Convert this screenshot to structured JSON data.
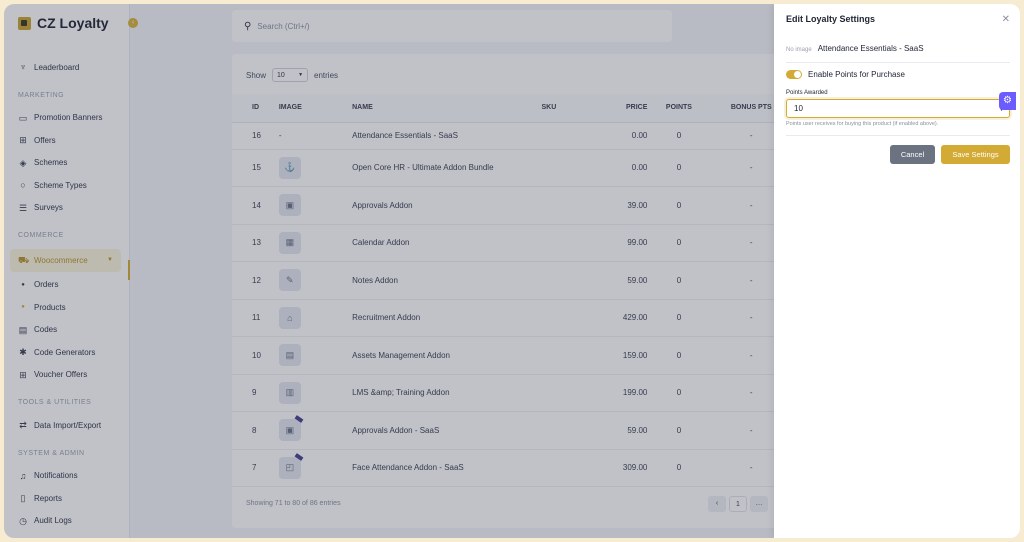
{
  "brand": {
    "name": "CZ Loyalty"
  },
  "sidebar": {
    "top_items": [
      {
        "label": "Leaderboard",
        "icon": "trophy-icon"
      }
    ],
    "sections": [
      {
        "label": "MARKETING",
        "items": [
          "Promotion Banners",
          "Offers",
          "Schemes",
          "Scheme Types",
          "Surveys"
        ]
      },
      {
        "label": "COMMERCE",
        "items": [
          "Woocommerce",
          "Orders",
          "Products",
          "Codes",
          "Code Generators",
          "Voucher Offers"
        ]
      },
      {
        "label": "TOOLS & UTILITIES",
        "items": [
          "Data Import/Export"
        ]
      },
      {
        "label": "SYSTEM & ADMIN",
        "items": [
          "Notifications",
          "Reports",
          "Audit Logs"
        ]
      }
    ]
  },
  "search": {
    "placeholder": "Search (Ctrl+/)"
  },
  "table": {
    "show_label": "Show",
    "entries_label": "entries",
    "page_size": "10",
    "columns": [
      "ID",
      "IMAGE",
      "NAME",
      "SKU",
      "PRICE",
      "POINTS",
      "BONUS PTS"
    ],
    "rows": [
      {
        "id": "16",
        "image": "-",
        "name": "Attendance Essentials - SaaS",
        "sku": "",
        "price": "0.00",
        "points": "0",
        "bonus": "-"
      },
      {
        "id": "15",
        "image": "",
        "name": "Open Core HR - Ultimate Addon Bundle",
        "sku": "",
        "price": "0.00",
        "points": "0",
        "bonus": "-"
      },
      {
        "id": "14",
        "image": "",
        "name": "Approvals Addon",
        "sku": "",
        "price": "39.00",
        "points": "0",
        "bonus": "-"
      },
      {
        "id": "13",
        "image": "",
        "name": "Calendar Addon",
        "sku": "",
        "price": "99.00",
        "points": "0",
        "bonus": "-"
      },
      {
        "id": "12",
        "image": "",
        "name": "Notes Addon",
        "sku": "",
        "price": "59.00",
        "points": "0",
        "bonus": "-"
      },
      {
        "id": "11",
        "image": "",
        "name": "Recruitment Addon",
        "sku": "",
        "price": "429.00",
        "points": "0",
        "bonus": "-"
      },
      {
        "id": "10",
        "image": "",
        "name": "Assets Management Addon",
        "sku": "",
        "price": "159.00",
        "points": "0",
        "bonus": "-"
      },
      {
        "id": "9",
        "image": "",
        "name": "LMS &amp; Training Addon",
        "sku": "",
        "price": "199.00",
        "points": "0",
        "bonus": "-"
      },
      {
        "id": "8",
        "image": "",
        "name": "Approvals Addon - SaaS",
        "sku": "",
        "price": "59.00",
        "points": "0",
        "bonus": "-"
      },
      {
        "id": "7",
        "image": "",
        "name": "Face Attendance Addon - SaaS",
        "sku": "",
        "price": "309.00",
        "points": "0",
        "bonus": "-"
      }
    ],
    "footer_info": "Showing 71 to 80 of 86 entries",
    "pager": [
      "‹",
      "1",
      "…"
    ]
  },
  "drawer": {
    "title": "Edit Loyalty Settings",
    "no_image": "No image",
    "product_name": "Attendance Essentials - SaaS",
    "toggle_label": "Enable Points for Purchase",
    "toggle_on": true,
    "points_label": "Points Awarded",
    "points_value": "10",
    "help_text": "Points user receives for buying this product (if enabled above).",
    "cancel_label": "Cancel",
    "save_label": "Save Settings"
  },
  "colors": {
    "accent": "#d3ab34",
    "cancel": "#6b7380",
    "fab": "#6a5cff"
  }
}
